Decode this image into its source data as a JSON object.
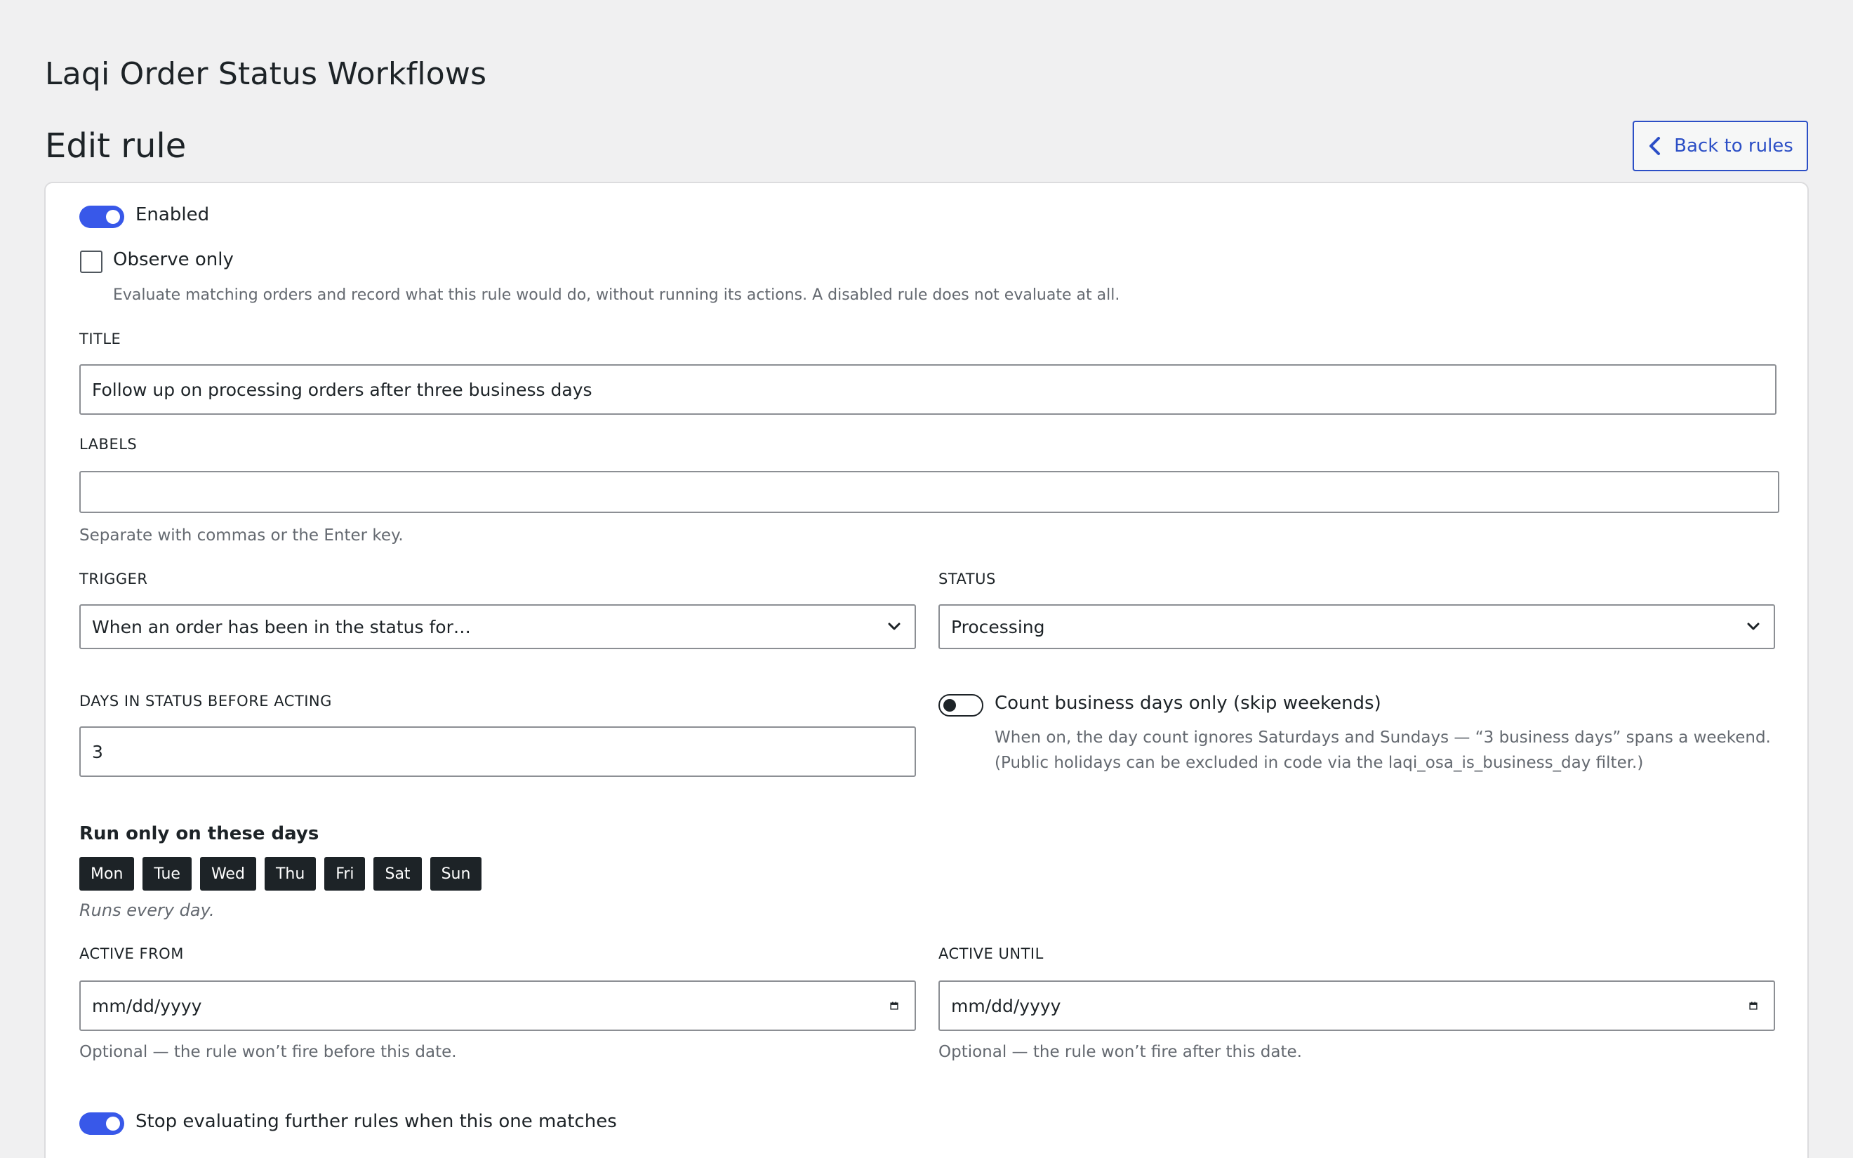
{
  "app_title": "Laqi Order Status Workflows",
  "page_title": "Edit rule",
  "back_button": {
    "label": "Back to rules",
    "icon": "chevron-left-icon"
  },
  "enabled": {
    "label": "Enabled",
    "state": true
  },
  "observe_only": {
    "label": "Observe only",
    "checked": false,
    "help": "Evaluate matching orders and record what this rule would do, without running its actions. A disabled rule does not evaluate at all."
  },
  "title_field": {
    "label": "TITLE",
    "value": "Follow up on processing orders after three business days"
  },
  "labels_field": {
    "label": "LABELS",
    "value": "",
    "help": "Separate with commas or the Enter key."
  },
  "trigger_field": {
    "label": "TRIGGER",
    "value": "When an order has been in the status for…"
  },
  "status_field": {
    "label": "STATUS",
    "value": "Processing"
  },
  "days_field": {
    "label": "DAYS IN STATUS BEFORE ACTING",
    "value": "3"
  },
  "business_days": {
    "label": "Count business days only (skip weekends)",
    "state": false,
    "help": "When on, the day count ignores Saturdays and Sundays — “3 business days” spans a weekend. (Public holidays can be excluded in code via the laqi_osa_is_business_day filter.)"
  },
  "run_days": {
    "heading": "Run only on these days",
    "days": [
      "Mon",
      "Tue",
      "Wed",
      "Thu",
      "Fri",
      "Sat",
      "Sun"
    ],
    "summary": "Runs every day."
  },
  "active_from": {
    "label": "ACTIVE FROM",
    "placeholder": "mm/dd/yyyy",
    "help": "Optional — the rule won’t fire before this date."
  },
  "active_until": {
    "label": "ACTIVE UNTIL",
    "placeholder": "mm/dd/yyyy",
    "help": "Optional — the rule won’t fire after this date."
  },
  "stop_evaluating": {
    "label": "Stop evaluating further rules when this one matches",
    "state": true
  },
  "colors": {
    "accent": "#3858e9",
    "link": "#2c4fc6",
    "background": "#f0f0f1",
    "day_chip": "#1d2327"
  }
}
